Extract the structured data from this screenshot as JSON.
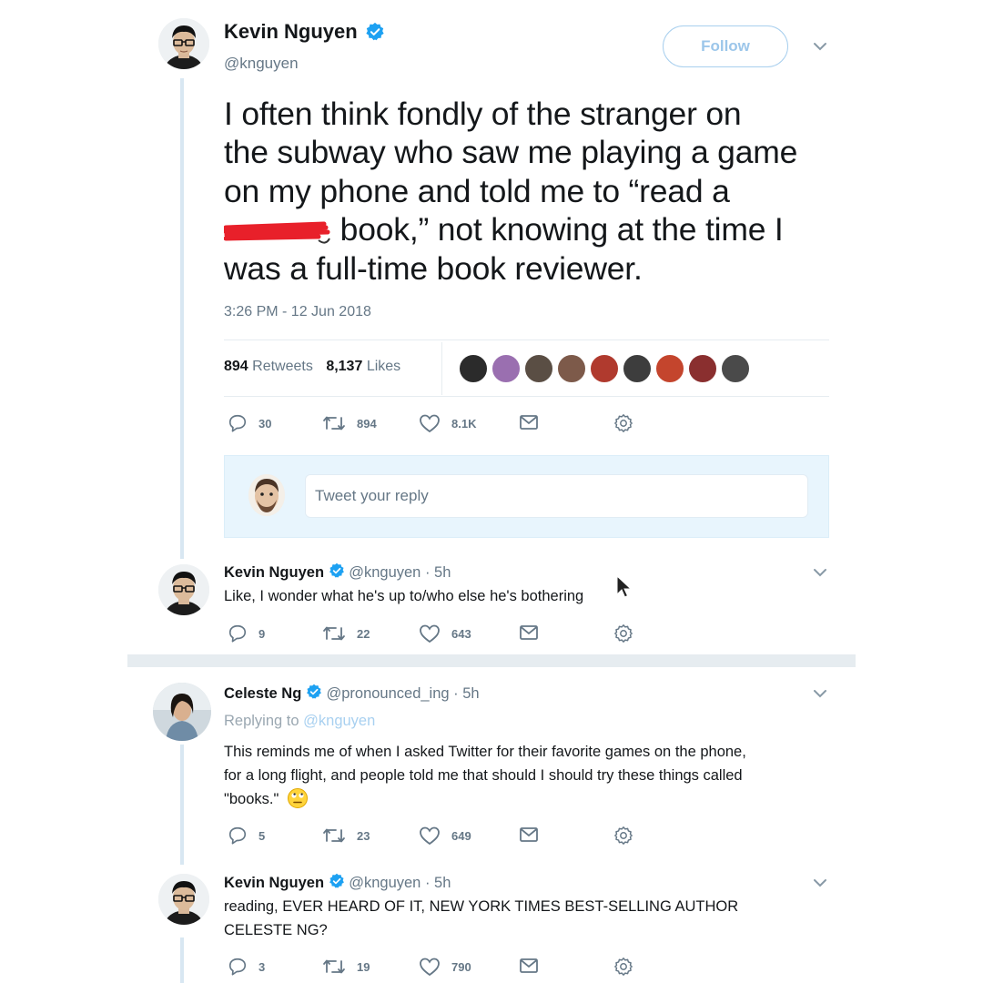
{
  "main_tweet": {
    "author_name": "Kevin Nguyen",
    "handle": "@knguyen",
    "follow_label": "Follow",
    "text_lines": [
      "I often think fondly of the stranger on",
      "the subway who saw me playing a game",
      "on my phone and told me to “read a",
      " book,” not knowing at the time I",
      "was a full-time book reviewer."
    ],
    "timestamp": "3:26 PM - 12 Jun 2018",
    "retweets_count": "894",
    "retweets_label": "Retweets",
    "likes_count": "8,137",
    "likes_label": "Likes",
    "actions": {
      "replies": "30",
      "retweets": "894",
      "likes": "8.1K"
    }
  },
  "reply_box": {
    "placeholder": "Tweet your reply"
  },
  "replies": [
    {
      "author_name": "Kevin Nguyen",
      "handle": "@knguyen",
      "time": "· 5h",
      "text": "Like, I wonder what he's up to/who else he's bothering",
      "actions": {
        "replies": "9",
        "retweets": "22",
        "likes": "643"
      }
    },
    {
      "author_name": "Celeste Ng",
      "handle": "@pronounced_ing",
      "time": "· 5h",
      "replying_prefix": "Replying to",
      "replying_to": "@knguyen",
      "text_lines": [
        "This reminds me of when I asked Twitter for their favorite games on the phone,",
        "for a long flight, and people told me that should I should try these things called",
        "\"books.\""
      ],
      "actions": {
        "replies": "5",
        "retweets": "23",
        "likes": "649"
      }
    },
    {
      "author_name": "Kevin Nguyen",
      "handle": "@knguyen",
      "time": "· 5h",
      "text_lines": [
        "reading, EVER HEARD OF IT, NEW YORK TIMES BEST-SELLING AUTHOR",
        "CELESTE NG?"
      ],
      "actions": {
        "replies": "3",
        "retweets": "19",
        "likes": "790"
      }
    }
  ],
  "colors": {
    "verified": "#1da1f2",
    "muted": "#657786",
    "thread_line": "#d8e7f2",
    "reply_box_bg": "#e8f5fd",
    "redaction": "#e8202a"
  }
}
